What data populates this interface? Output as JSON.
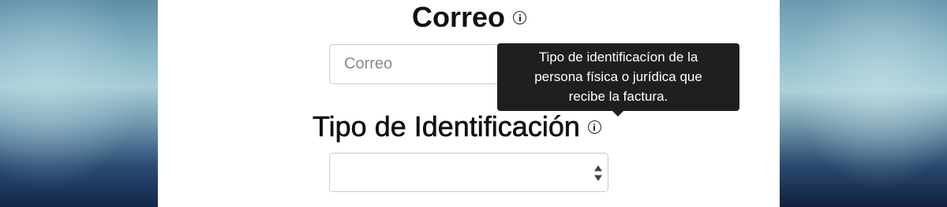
{
  "form": {
    "email": {
      "label": "Correo",
      "placeholder": "Correo",
      "value": "",
      "info_icon": "info-circle-icon"
    },
    "id_type": {
      "label": "Tipo de Identificación",
      "selected_value": "",
      "info_icon": "info-circle-icon",
      "arrows_icon": "select-arrows-icon"
    }
  },
  "tooltip": {
    "lines": [
      "Tipo de identificacíon de la",
      "persona física o jurídica que",
      "recibe la factura."
    ]
  },
  "colors": {
    "panel_background": "#ffffff",
    "tooltip_background": "#1f1f1f",
    "input_border": "#c9c9c9",
    "label_text": "#111111"
  }
}
